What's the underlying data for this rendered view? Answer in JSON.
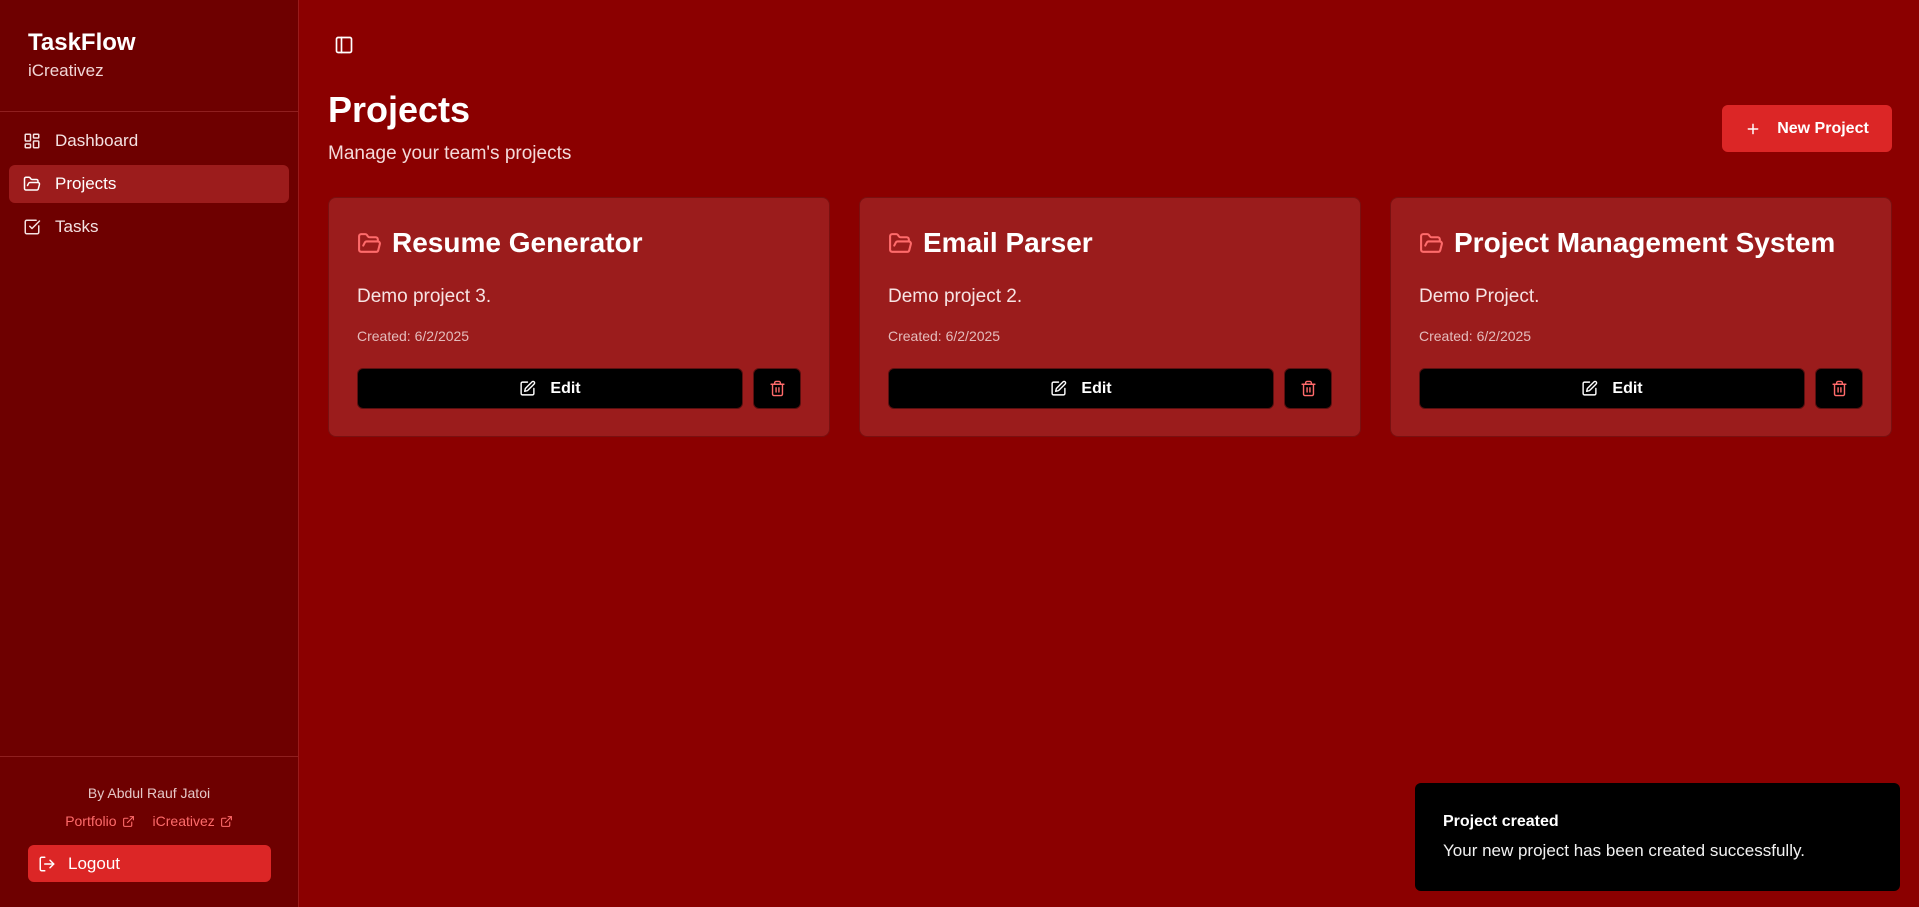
{
  "app": {
    "title": "TaskFlow",
    "subtitle": "iCreativez"
  },
  "sidebar": {
    "items": [
      {
        "label": "Dashboard",
        "icon": "dashboard-icon"
      },
      {
        "label": "Projects",
        "icon": "folder-open-icon",
        "active": true
      },
      {
        "label": "Tasks",
        "icon": "checkbox-icon"
      }
    ],
    "footer": {
      "byline": "By Abdul Rauf Jatoi",
      "links": [
        {
          "label": "Portfolio",
          "icon": "external-link-icon"
        },
        {
          "label": "iCreativez",
          "icon": "external-link-icon"
        }
      ],
      "logout_label": "Logout"
    }
  },
  "header": {
    "title": "Projects",
    "subtitle": "Manage your team's projects",
    "new_project_label": "New Project"
  },
  "projects": [
    {
      "name": "Resume Generator",
      "description": "Demo project 3.",
      "created": "Created: 6/2/2025",
      "edit_label": "Edit"
    },
    {
      "name": "Email Parser",
      "description": "Demo project 2.",
      "created": "Created: 6/2/2025",
      "edit_label": "Edit"
    },
    {
      "name": "Project Management System",
      "description": "Demo Project.",
      "created": "Created: 6/2/2025",
      "edit_label": "Edit"
    }
  ],
  "toast": {
    "title": "Project created",
    "message": "Your new project has been created successfully."
  },
  "colors": {
    "background": "#8b0000",
    "sidebar": "#6e0000",
    "card": "#9b1c1c",
    "accent": "#dc2626",
    "link": "#ff6b6b"
  }
}
